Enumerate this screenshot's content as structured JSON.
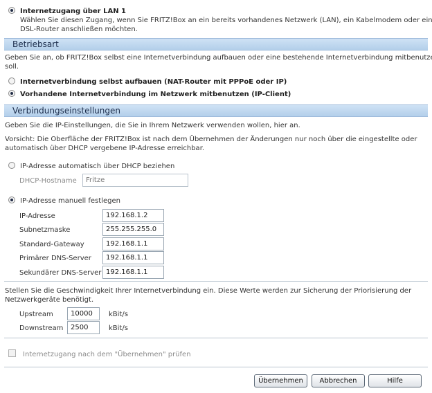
{
  "lan_option": {
    "label": "Internetzugang über LAN 1",
    "desc_line1": "Wählen Sie diesen Zugang, wenn Sie FRITZ!Box an ein bereits vorhandenes Netzwerk (LAN), ein Kabelmodem oder einen",
    "desc_line2": "DSL-Router anschließen möchten."
  },
  "betriebsart": {
    "title": "Betriebsart",
    "desc_line1": "Geben Sie an, ob FRITZ!Box selbst eine Internetverbindung aufbauen oder eine bestehende Internetverbindung mitbenutzen",
    "desc_line2": "soll.",
    "option_nat": "Internetverbindung selbst aufbauen (NAT-Router mit PPPoE oder IP)",
    "option_client": "Vorhandene Internetverbindung im Netzwerk mitbenutzen (IP-Client)"
  },
  "verbindung": {
    "title": "Verbindungseinstellungen",
    "desc": "Geben Sie die IP-Einstellungen, die Sie in Ihrem Netzwerk verwenden wollen, hier an.",
    "warn_line1": "Vorsicht: Die Oberfläche der FRITZ!Box ist nach dem Übernehmen der Änderungen nur noch über die eingestellte oder",
    "warn_line2": "automatisch über DHCP vergebene IP-Adresse erreichbar.",
    "dhcp_option": "IP-Adresse automatisch über DHCP beziehen",
    "dhcp_hostname_label": "DHCP-Hostname",
    "dhcp_hostname_value": "Fritze",
    "manual_option": "IP-Adresse manuell festlegen",
    "fields": [
      {
        "label": "IP-Adresse",
        "value": "192.168.1.2"
      },
      {
        "label": "Subnetzmaske",
        "value": "255.255.255.0"
      },
      {
        "label": "Standard-Gateway",
        "value": "192.168.1.1"
      },
      {
        "label": "Primärer DNS-Server",
        "value": "192.168.1.1"
      },
      {
        "label": "Sekundärer DNS-Server",
        "value": "192.168.1.1"
      }
    ]
  },
  "speed": {
    "desc_line1": "Stellen Sie die Geschwindigkeit Ihrer Internetverbindung ein. Diese Werte werden zur Sicherung der Priorisierung der",
    "desc_line2": "Netzwerkgeräte benötigt.",
    "upstream_label": "Upstream",
    "upstream_value": "10000",
    "downstream_label": "Downstream",
    "downstream_value": "2500",
    "unit": "kBit/s"
  },
  "check_label": "Internetzugang nach dem \"Übernehmen\" prüfen",
  "buttons": {
    "apply": "Übernehmen",
    "cancel": "Abbrechen",
    "help": "Hilfe"
  }
}
